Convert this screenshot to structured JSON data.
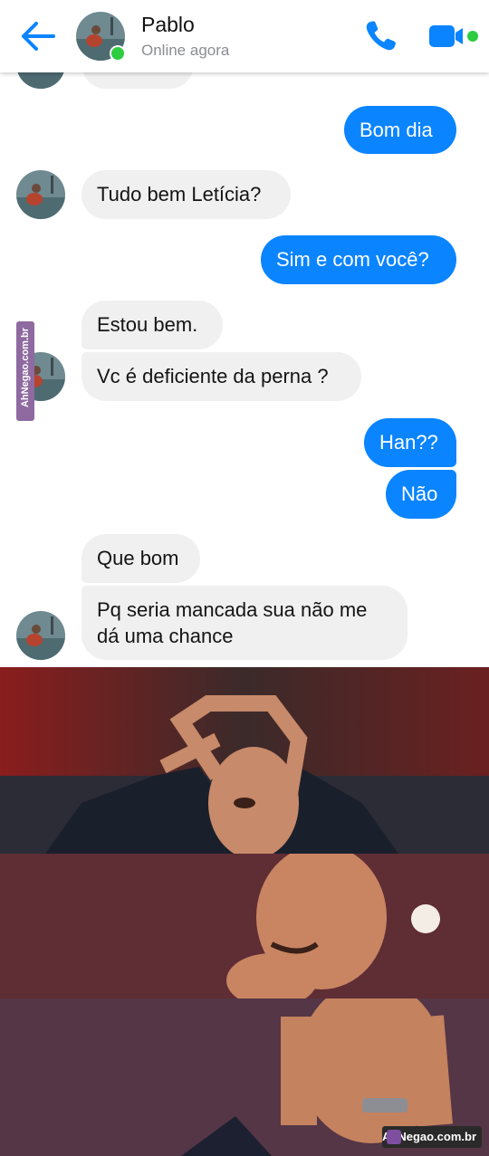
{
  "header": {
    "contact_name": "Pablo",
    "status": "Online agora",
    "accent_color": "#0a84ff",
    "online_color": "#2ecc40",
    "icons": [
      "back-arrow-icon",
      "phone-icon",
      "video-camera-icon"
    ]
  },
  "messages": [
    {
      "from": "them",
      "text": ""
    },
    {
      "from": "me",
      "text": "Bom dia"
    },
    {
      "from": "them",
      "text": "Tudo bem Letícia?"
    },
    {
      "from": "me",
      "text": "Sim e com você?"
    },
    {
      "from": "them",
      "text": "Estou bem."
    },
    {
      "from": "them",
      "text": "Vc é deficiente da perna ?"
    },
    {
      "from": "me",
      "text": "Han??"
    },
    {
      "from": "me",
      "text": "Não"
    },
    {
      "from": "them",
      "text": "Que bom"
    },
    {
      "from": "them",
      "lines": [
        "Pq seria mancada sua não me",
        "dá uma chance"
      ]
    }
  ],
  "watermarks": {
    "side": "AhNegao.com.br",
    "corner": "AhNegao.com.br"
  }
}
